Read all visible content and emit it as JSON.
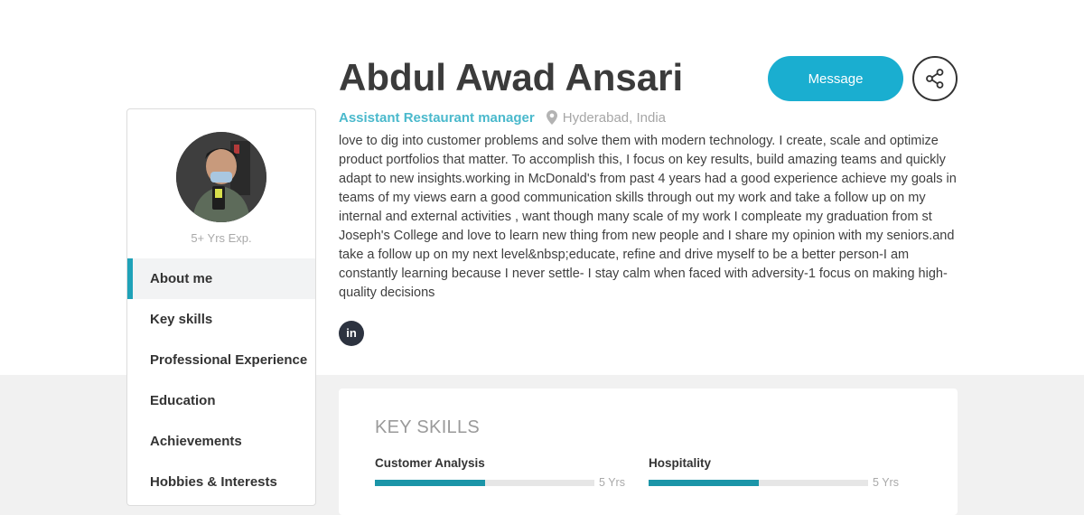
{
  "profile": {
    "name": "Abdul Awad Ansari",
    "job_title": "Assistant Restaurant manager",
    "location": "Hyderabad, India",
    "experience": "5+ Yrs Exp.",
    "bio": "love to dig into customer problems and solve them with modern technology. I create, scale and optimize product portfolios that matter. To accomplish this, I focus on key results, build amazing teams and quickly adapt to new insights.working in McDonald's from past 4 years had a good experience achieve my goals in teams of my views earn a good communication skills through out my work and take a follow up on my internal and external activities , want though many scale of my work I compleate my graduation from st Joseph's College and love to learn new thing from new people and I share my opinion with my seniors.and take a follow up on my next level&nbsp;educate, refine and drive myself to be a better person-I am constantly learning because I never settle- I stay calm when faced with adversity-1 focus on making high-quality decisions"
  },
  "actions": {
    "message_label": "Message",
    "share_icon": "share-icon",
    "linkedin_label": "in"
  },
  "sidebar": {
    "items": [
      {
        "label": "About me",
        "active": true
      },
      {
        "label": "Key skills",
        "active": false
      },
      {
        "label": "Professional Experience",
        "active": false
      },
      {
        "label": "Education",
        "active": false
      },
      {
        "label": "Achievements",
        "active": false
      },
      {
        "label": "Hobbies & Interests",
        "active": false
      }
    ]
  },
  "skills": {
    "title": "KEY SKILLS",
    "items": [
      {
        "name": "Customer Analysis",
        "years": "5 Yrs",
        "level_fraction": 0.5
      },
      {
        "name": "Hospitality",
        "years": "5 Yrs",
        "level_fraction": 0.5
      }
    ]
  },
  "colors": {
    "accent": "#1aaed0",
    "active_border": "#1fa2b8",
    "skill_fill": "#1b95a8",
    "job_title": "#4ab9cc"
  }
}
